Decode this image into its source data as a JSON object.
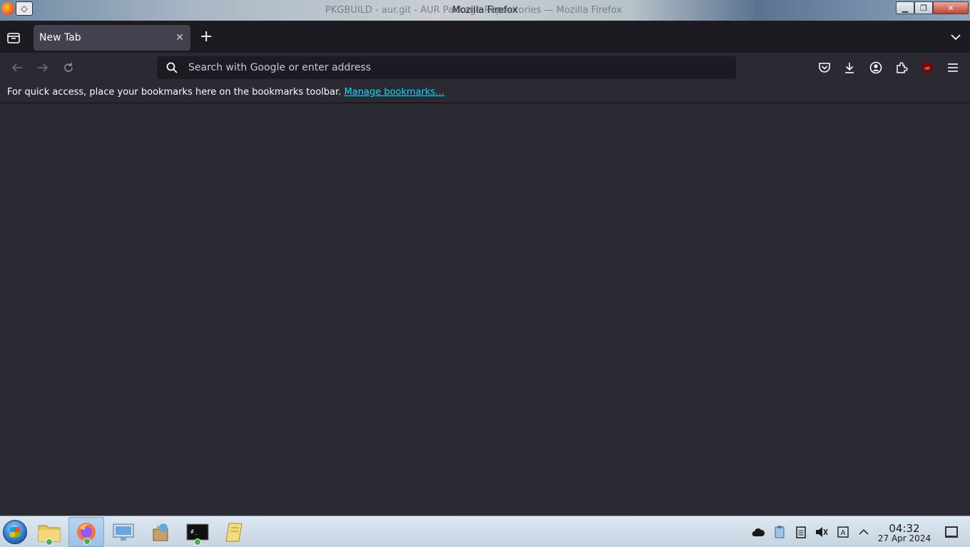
{
  "window": {
    "title": "Mozilla Firefox",
    "background_title": "PKGBUILD - aur.git - AUR Package Repositories — Mozilla Firefox"
  },
  "tabs": [
    {
      "label": "New Tab",
      "active": true
    }
  ],
  "urlbar": {
    "placeholder": "Search with Google or enter address",
    "value": ""
  },
  "bookmarks_bar": {
    "message": "For quick access, place your bookmarks here on the bookmarks toolbar.",
    "link_label": "Manage bookmarks…"
  },
  "toolbar_icons": [
    "pocket-icon",
    "downloads-icon",
    "account-icon",
    "extensions-icon",
    "ublock-icon",
    "menu-icon"
  ],
  "taskbar": {
    "apps": [
      "file-manager",
      "firefox",
      "network-settings",
      "package-installer",
      "terminal",
      "notes"
    ],
    "clock": {
      "time": "04:32",
      "date": "27 Apr 2024"
    },
    "tray_icons": [
      "cloud-icon",
      "clipboard-icon",
      "notes-icon",
      "volume-muted-icon",
      "input-method-icon",
      "chevron-up-icon"
    ]
  },
  "colors": {
    "toolbar_bg": "#2b2a33",
    "tabstrip_bg": "#1c1b22",
    "link": "#00ddff",
    "active_tab": "#42414d"
  }
}
